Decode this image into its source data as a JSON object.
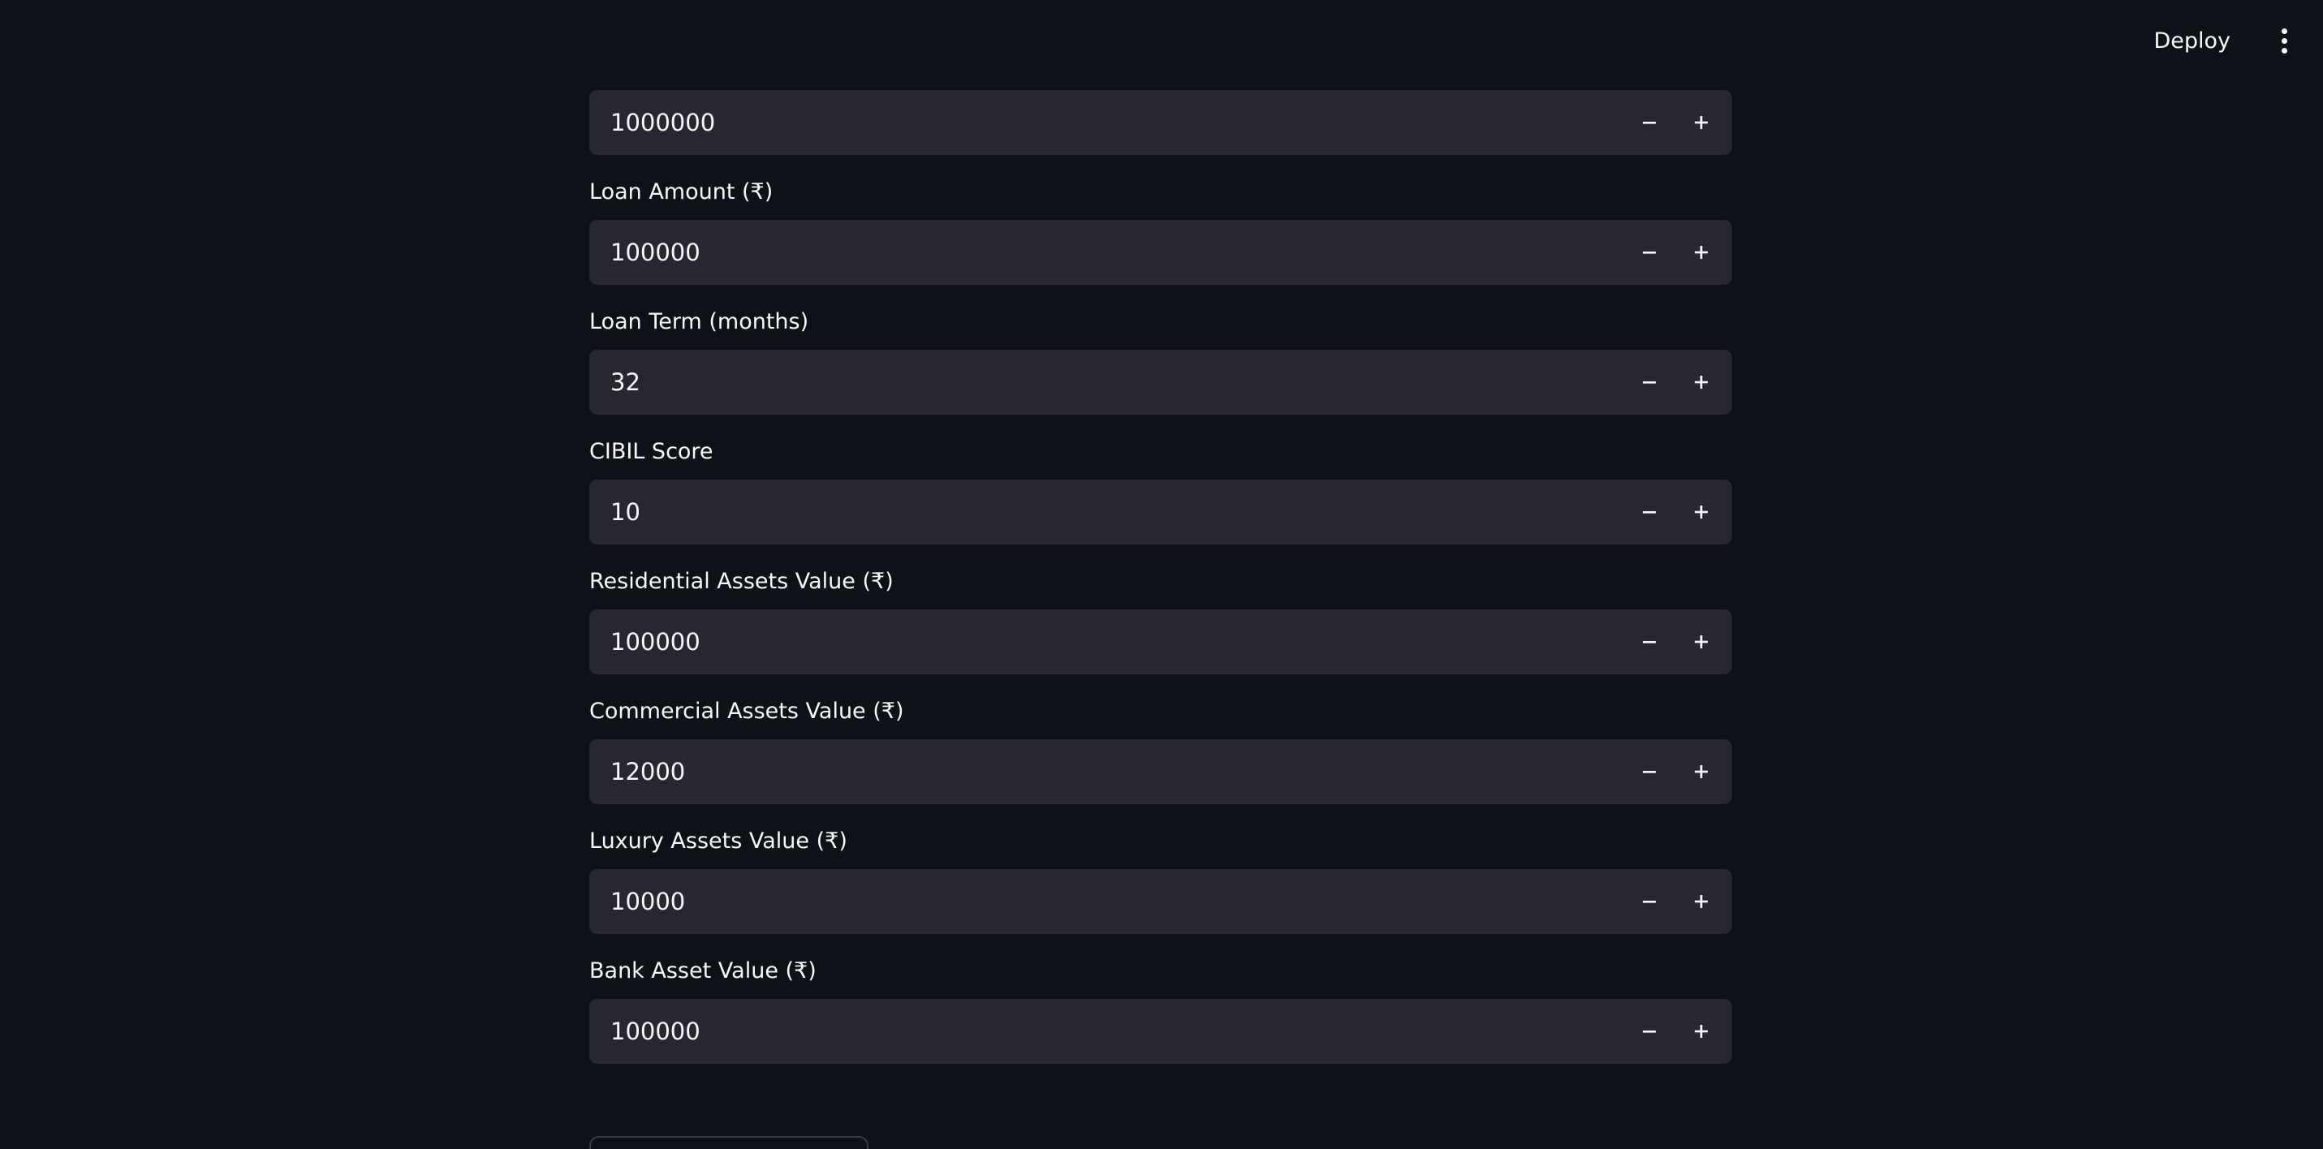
{
  "header": {
    "deploy_label": "Deploy"
  },
  "fields": [
    {
      "label": "",
      "value": "1000000"
    },
    {
      "label": "Loan Amount (₹)",
      "value": "100000"
    },
    {
      "label": "Loan Term (months)",
      "value": "32"
    },
    {
      "label": "CIBIL Score",
      "value": "10"
    },
    {
      "label": "Residential Assets Value (₹)",
      "value": "100000"
    },
    {
      "label": "Commercial Assets Value (₹)",
      "value": "12000"
    },
    {
      "label": "Luxury Assets Value (₹)",
      "value": "10000"
    },
    {
      "label": "Bank Asset Value (₹)",
      "value": "100000"
    }
  ],
  "icons": {
    "decrement": "minus-icon",
    "increment": "plus-icon",
    "menu": "vertical-dots-icon"
  },
  "colors": {
    "background": "#0e1117",
    "input_background": "#262730",
    "text": "#fafafa"
  }
}
